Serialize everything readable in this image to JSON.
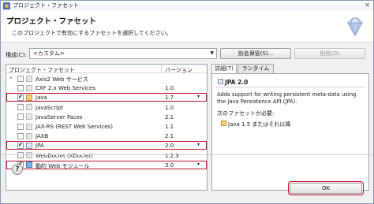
{
  "window": {
    "title": "プロジェクト・ファセット",
    "close_glyph": "✕"
  },
  "banner": {
    "heading": "プロジェクト・ファセット",
    "description": "このプロジェクトで有効にするファセットを選択してください。"
  },
  "config": {
    "label": "構成(C):",
    "value": "<カスタム>",
    "save_button": "別名保管(S)...",
    "delete_button": "削除(D)"
  },
  "facets": {
    "column_facet": "プロジェクト・ファセット",
    "column_version": "バージョン",
    "rows": [
      {
        "name": "Axis2 Web サービス",
        "version": "",
        "checked": false,
        "expander": "▸",
        "highlight": false,
        "icon": "facet-icon"
      },
      {
        "name": "CXF 2.x Web Services",
        "version": "1.0",
        "checked": false,
        "expander": "",
        "highlight": false,
        "icon": "facet-icon"
      },
      {
        "name": "Java",
        "version": "1.7",
        "checked": true,
        "expander": "",
        "highlight": true,
        "icon": "java-icon"
      },
      {
        "name": "JavaScript",
        "version": "1.0",
        "checked": false,
        "expander": "",
        "highlight": false,
        "icon": "facet-icon"
      },
      {
        "name": "JavaServer Faces",
        "version": "2.1",
        "checked": false,
        "expander": "",
        "highlight": false,
        "icon": "facet-icon"
      },
      {
        "name": "JAX-RS (REST Web Services)",
        "version": "1.1",
        "checked": false,
        "expander": "",
        "highlight": false,
        "icon": "facet-icon"
      },
      {
        "name": "JAXB",
        "version": "2.1",
        "checked": false,
        "expander": "",
        "highlight": false,
        "icon": "facet-icon"
      },
      {
        "name": "JPA",
        "version": "2.0",
        "checked": true,
        "expander": "",
        "highlight": true,
        "icon": "jpa-icon"
      },
      {
        "name": "WebDoclet (XDoclet)",
        "version": "1.2.3",
        "checked": false,
        "expander": "",
        "highlight": false,
        "icon": "facet-icon"
      },
      {
        "name": "動的 Web モジュール",
        "version": "3.0",
        "checked": true,
        "expander": "",
        "highlight": true,
        "icon": "web-icon"
      }
    ]
  },
  "details": {
    "tab_details": "詳細(T)",
    "tab_runtimes": "ランタイム(R)",
    "facet_title": "JPA 2.0",
    "description": "Adds support for writing persistent meta-data using the Java Persistence API (JPA).",
    "requires_label": "次のファセットが必要:",
    "requires_item": "Java 1.5 またはそれ以降"
  },
  "footer": {
    "help_glyph": "?",
    "ok_button": "OK"
  },
  "colors": {
    "highlight": "#c8102e",
    "border": "#9aa6b6"
  }
}
